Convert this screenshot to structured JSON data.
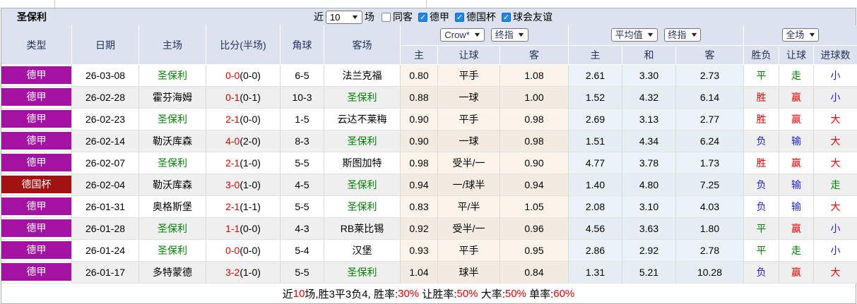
{
  "team_name": "圣保利",
  "title_bar": {
    "title": "圣保利",
    "recent_label": "近",
    "recent_select": "10",
    "games_label": "场",
    "checkboxes": [
      {
        "label": "同客",
        "checked": false
      },
      {
        "label": "德甲",
        "checked": true
      },
      {
        "label": "德国杯",
        "checked": true
      },
      {
        "label": "球会友谊",
        "checked": true
      }
    ]
  },
  "header": {
    "static_cols": [
      "类型",
      "日期",
      "主场",
      "比分(半场)",
      "角球",
      "客场"
    ],
    "asian_group": {
      "selects": [
        "Crow*",
        "终指"
      ],
      "cols": [
        "主",
        "让球",
        "客"
      ]
    },
    "euro_group": {
      "selects": [
        "平均值",
        "终指"
      ],
      "cols": [
        "主",
        "和",
        "客"
      ]
    },
    "result_group": {
      "selects": [
        "全场"
      ],
      "cols": [
        "胜负",
        "让球",
        "进球数"
      ]
    }
  },
  "rows": [
    {
      "type": "德甲",
      "date": "26-03-08",
      "home": "圣保利",
      "score": "0-0",
      "half": "(0-0)",
      "corner": "6-5",
      "away": "法兰克福",
      "asian_home": "0.80",
      "handicap": "平手",
      "asian_away": "1.08",
      "euro_home": "2.61",
      "euro_draw": "3.30",
      "euro_away": "2.73",
      "result_wdl": "平",
      "result_handicap": "走",
      "result_goals": "小"
    },
    {
      "type": "德甲",
      "date": "26-02-28",
      "home": "霍芬海姆",
      "score": "0-1",
      "half": "(0-1)",
      "corner": "10-3",
      "away": "圣保利",
      "asian_home": "0.88",
      "handicap": "一球",
      "asian_away": "1.00",
      "euro_home": "1.52",
      "euro_draw": "4.32",
      "euro_away": "6.14",
      "result_wdl": "胜",
      "result_handicap": "赢",
      "result_goals": "小"
    },
    {
      "type": "德甲",
      "date": "26-02-23",
      "home": "圣保利",
      "score": "2-1",
      "half": "(0-0)",
      "corner": "1-5",
      "away": "云达不莱梅",
      "asian_home": "0.90",
      "handicap": "平手",
      "asian_away": "0.98",
      "euro_home": "2.69",
      "euro_draw": "3.13",
      "euro_away": "2.77",
      "result_wdl": "胜",
      "result_handicap": "赢",
      "result_goals": "大"
    },
    {
      "type": "德甲",
      "date": "26-02-14",
      "home": "勒沃库森",
      "score": "4-0",
      "half": "(2-0)",
      "corner": "8-3",
      "away": "圣保利",
      "asian_home": "0.90",
      "handicap": "一球",
      "asian_away": "0.98",
      "euro_home": "1.51",
      "euro_draw": "4.34",
      "euro_away": "6.24",
      "result_wdl": "负",
      "result_handicap": "输",
      "result_goals": "大"
    },
    {
      "type": "德甲",
      "date": "26-02-07",
      "home": "圣保利",
      "score": "2-1",
      "half": "(1-0)",
      "corner": "5-5",
      "away": "斯图加特",
      "asian_home": "0.98",
      "handicap": "受半/一",
      "asian_away": "0.90",
      "euro_home": "4.77",
      "euro_draw": "3.78",
      "euro_away": "1.73",
      "result_wdl": "胜",
      "result_handicap": "赢",
      "result_goals": "大"
    },
    {
      "type": "德国杯",
      "date": "26-02-04",
      "home": "勒沃库森",
      "score": "3-0",
      "half": "(1-0)",
      "corner": "4-5",
      "away": "圣保利",
      "asian_home": "0.94",
      "handicap": "一/球半",
      "asian_away": "0.94",
      "euro_home": "1.40",
      "euro_draw": "4.80",
      "euro_away": "7.25",
      "result_wdl": "负",
      "result_handicap": "输",
      "result_goals": "走"
    },
    {
      "type": "德甲",
      "date": "26-01-31",
      "home": "奥格斯堡",
      "score": "2-1",
      "half": "(1-1)",
      "corner": "5-5",
      "away": "圣保利",
      "asian_home": "0.83",
      "handicap": "平/半",
      "asian_away": "1.05",
      "euro_home": "2.08",
      "euro_draw": "3.10",
      "euro_away": "4.03",
      "result_wdl": "负",
      "result_handicap": "输",
      "result_goals": "大"
    },
    {
      "type": "德甲",
      "date": "26-01-28",
      "home": "圣保利",
      "score": "1-1",
      "half": "(0-0)",
      "corner": "4-3",
      "away": "RB莱比锡",
      "asian_home": "0.92",
      "handicap": "受半/一",
      "asian_away": "0.96",
      "euro_home": "4.56",
      "euro_draw": "3.63",
      "euro_away": "1.80",
      "result_wdl": "平",
      "result_handicap": "赢",
      "result_goals": "小"
    },
    {
      "type": "德甲",
      "date": "26-01-24",
      "home": "圣保利",
      "score": "0-0",
      "half": "(0-0)",
      "corner": "5-4",
      "away": "汉堡",
      "asian_home": "0.93",
      "handicap": "平手",
      "asian_away": "0.95",
      "euro_home": "2.86",
      "euro_draw": "2.92",
      "euro_away": "2.78",
      "result_wdl": "平",
      "result_handicap": "走",
      "result_goals": "小"
    },
    {
      "type": "德甲",
      "date": "26-01-17",
      "home": "多特蒙德",
      "score": "3-2",
      "half": "(1-0)",
      "corner": "5-5",
      "away": "圣保利",
      "asian_home": "1.04",
      "handicap": "球半",
      "asian_away": "0.84",
      "euro_home": "1.31",
      "euro_draw": "5.21",
      "euro_away": "10.28",
      "result_wdl": "负",
      "result_handicap": "赢",
      "result_goals": "大"
    }
  ],
  "footer": {
    "parts": [
      {
        "text": "近"
      },
      {
        "text": "10",
        "red": true
      },
      {
        "text": "场,胜3平3负4, 胜率:"
      },
      {
        "text": "30%",
        "red": true
      },
      {
        "text": " 让胜率:"
      },
      {
        "text": "50%",
        "red": true
      },
      {
        "text": " 大率:"
      },
      {
        "text": "50%",
        "red": true
      },
      {
        "text": " 单率:"
      },
      {
        "text": "60%",
        "red": true
      }
    ]
  },
  "colors": {
    "header_bg": "#dce3ee",
    "header_text": "#26335c",
    "league": {
      "德甲": "#a312a3",
      "德国杯": "#a31212"
    },
    "asian_odds_bg": "#fcf4ea",
    "euro_odds_bg": "#eaf3f8",
    "red": "#e60000",
    "green": "#008000",
    "blue": "#2222dd",
    "checkbox_checked": "#1e88e5",
    "result_map": {
      "胜": "red",
      "赢": "red",
      "大": "red",
      "平": "green",
      "走": "green",
      "负": "blue",
      "输": "blue",
      "小": "blue"
    }
  }
}
